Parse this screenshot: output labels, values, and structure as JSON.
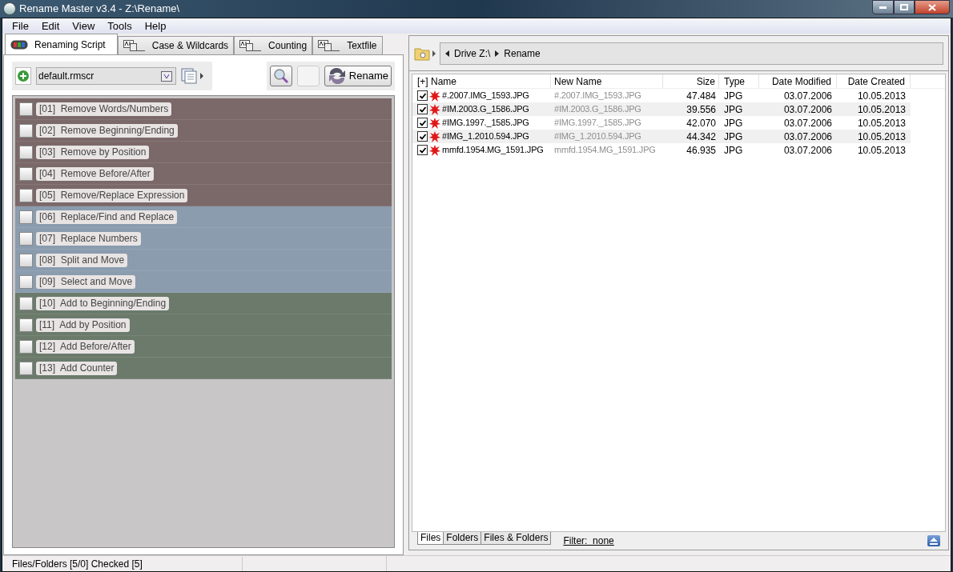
{
  "window": {
    "title": "Rename Master v3.4 - Z:\\Rename\\"
  },
  "menu": [
    "File",
    "Edit",
    "View",
    "Tools",
    "Help"
  ],
  "tabs": [
    {
      "label": "Renaming Script",
      "selected": true
    },
    {
      "label": "Case & Wildcards",
      "selected": false
    },
    {
      "label": "Counting",
      "selected": false
    },
    {
      "label": "Textfile",
      "selected": false
    }
  ],
  "script_file": {
    "value": "default.rmscr"
  },
  "rename_button": "Rename",
  "script_items": [
    {
      "label": "[01]  Remove Words/Numbers",
      "checked": false,
      "color": "#7b6869"
    },
    {
      "label": "[02]  Remove Beginning/Ending",
      "checked": false,
      "color": "#7b6869"
    },
    {
      "label": "[03]  Remove by Position",
      "checked": false,
      "color": "#7b6869"
    },
    {
      "label": "[04]  Remove Before/After",
      "checked": false,
      "color": "#7b6869"
    },
    {
      "label": "[05]  Remove/Replace Expression",
      "checked": false,
      "color": "#7b6869"
    },
    {
      "label": "[06]  Replace/Find and Replace",
      "checked": false,
      "color": "#8a9cae"
    },
    {
      "label": "[07]  Replace Numbers",
      "checked": false,
      "color": "#8a9cae"
    },
    {
      "label": "[08]  Split and Move",
      "checked": false,
      "color": "#8a9cae"
    },
    {
      "label": "[09]  Select and Move",
      "checked": false,
      "color": "#8a9cae"
    },
    {
      "label": "[10]  Add to Beginning/Ending",
      "checked": false,
      "color": "#6b7a6b"
    },
    {
      "label": "[11]  Add by Position",
      "checked": false,
      "color": "#6b7a6b"
    },
    {
      "label": "[12]  Add Before/After",
      "checked": false,
      "color": "#6b7a6b"
    },
    {
      "label": "[13]  Add Counter",
      "checked": false,
      "color": "#6b7a6b"
    }
  ],
  "breadcrumb": [
    "Drive Z:\\",
    "Rename"
  ],
  "table": {
    "columns": [
      "[+] Name",
      "New Name",
      "Size",
      "Type",
      "Date Modified",
      "Date Created"
    ],
    "rows": [
      {
        "checked": true,
        "name": "#.2007.IMG_1593.JPG",
        "new_name": "#.2007.IMG_1593.JPG",
        "size": "47.484",
        "type": "JPG",
        "modified": "03.07.2006",
        "created": "10.05.2013"
      },
      {
        "checked": true,
        "name": "#IM.2003.G_1586.JPG",
        "new_name": "#IM.2003.G_1586.JPG",
        "size": "39.556",
        "type": "JPG",
        "modified": "03.07.2006",
        "created": "10.05.2013"
      },
      {
        "checked": true,
        "name": "#IMG.1997._1585.JPG",
        "new_name": "#IMG.1997._1585.JPG",
        "size": "42.070",
        "type": "JPG",
        "modified": "03.07.2006",
        "created": "10.05.2013"
      },
      {
        "checked": true,
        "name": "#IMG_1.2010.594.JPG",
        "new_name": "#IMG_1.2010.594.JPG",
        "size": "44.342",
        "type": "JPG",
        "modified": "03.07.2006",
        "created": "10.05.2013"
      },
      {
        "checked": true,
        "name": "mmfd.1954.MG_1591.JPG",
        "new_name": "mmfd.1954.MG_1591.JPG",
        "size": "46.935",
        "type": "JPG",
        "modified": "03.07.2006",
        "created": "10.05.2013"
      }
    ]
  },
  "view_tabs": [
    {
      "label": "Files",
      "selected": true
    },
    {
      "label": "Folders",
      "selected": false
    },
    {
      "label": "Files & Folders",
      "selected": false
    }
  ],
  "filter_link": "Filter:  none",
  "status_bar": "Files/Folders [5/0] Checked [5]"
}
